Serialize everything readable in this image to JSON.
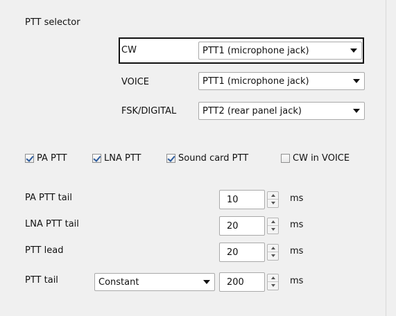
{
  "section_title": "PTT selector",
  "selectors": [
    {
      "label": "CW",
      "value": "PTT1 (microphone jack)"
    },
    {
      "label": "VOICE",
      "value": "PTT1 (microphone jack)"
    },
    {
      "label": "FSK/DIGITAL",
      "value": "PTT2 (rear panel jack)"
    }
  ],
  "checkboxes": [
    {
      "label": "PA PTT",
      "checked": true
    },
    {
      "label": "LNA PTT",
      "checked": true
    },
    {
      "label": "Sound card PTT",
      "checked": true
    },
    {
      "label": "CW in VOICE",
      "checked": false
    }
  ],
  "timing": [
    {
      "label": "PA PTT tail",
      "value": "10",
      "unit": "ms"
    },
    {
      "label": "LNA PTT tail",
      "value": "20",
      "unit": "ms"
    },
    {
      "label": "PTT lead",
      "value": "20",
      "unit": "ms"
    },
    {
      "label": "PTT tail",
      "value": "200",
      "unit": "ms",
      "mode": "Constant"
    }
  ],
  "colors": {
    "background": "#f0f0f0",
    "focus_border": "#111111",
    "check": "#2b5b9e"
  }
}
